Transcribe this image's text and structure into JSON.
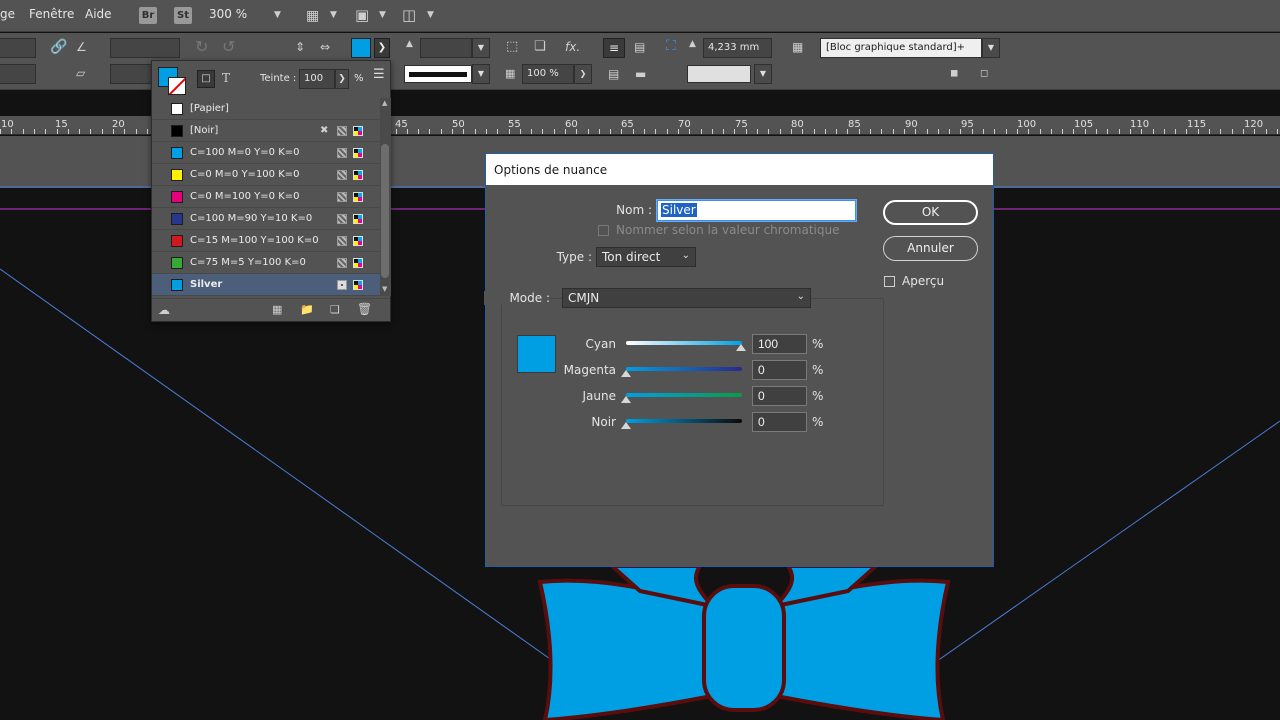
{
  "menubar": {
    "items": [
      "ge",
      "Fenêtre",
      "Aide"
    ],
    "bridge_badge": "Br",
    "stock_badge": "St",
    "zoom": "300 %"
  },
  "control": {
    "stroke_weight": "4,233 mm",
    "opacity": "100 %",
    "object_style": "[Bloc graphique standard]+"
  },
  "ruler": {
    "labels": [
      "10",
      "15",
      "20",
      "45",
      "50",
      "55",
      "60",
      "65",
      "70",
      "75",
      "80",
      "85",
      "90",
      "95",
      "100",
      "105",
      "110",
      "115",
      "120"
    ]
  },
  "swatches_panel": {
    "tint_label": "Teinte :",
    "tint_value": "100",
    "tint_unit": "%",
    "items": [
      {
        "label": "[Papier]",
        "color": "#ffffff",
        "kind": "none"
      },
      {
        "label": "[Noir]",
        "color": "#000000",
        "kind": "locked"
      },
      {
        "label": "C=100 M=0 Y=0 K=0",
        "color": "#00a0e6",
        "kind": "process"
      },
      {
        "label": "C=0 M=0 Y=100 K=0",
        "color": "#fff200",
        "kind": "process"
      },
      {
        "label": "C=0 M=100 Y=0 K=0",
        "color": "#e6007e",
        "kind": "process"
      },
      {
        "label": "C=100 M=90 Y=10 K=0",
        "color": "#27378c",
        "kind": "process"
      },
      {
        "label": "C=15 M=100 Y=100 K=0",
        "color": "#d0181f",
        "kind": "process"
      },
      {
        "label": "C=75 M=5 Y=100 K=0",
        "color": "#39a935",
        "kind": "process"
      },
      {
        "label": "Silver",
        "color": "#009fe3",
        "kind": "spot"
      }
    ]
  },
  "dialog": {
    "title": "Options de nuance",
    "name_label": "Nom :",
    "name_value": "Silver",
    "name_by_value_label": "Nommer selon la valeur chromatique",
    "type_label": "Type :",
    "type_value": "Ton direct",
    "mode_label": "Mode :",
    "mode_value": "CMJN",
    "ok_label": "OK",
    "cancel_label": "Annuler",
    "preview_label": "Aperçu",
    "swatch_color": "#009fe3",
    "channels": [
      {
        "label": "Cyan",
        "value": "100",
        "unit": "%"
      },
      {
        "label": "Magenta",
        "value": "0",
        "unit": "%"
      },
      {
        "label": "Jaune",
        "value": "0",
        "unit": "%"
      },
      {
        "label": "Noir",
        "value": "0",
        "unit": "%"
      }
    ]
  },
  "colors": {
    "accent_blue": "#009fe3",
    "bow_outline": "#5a0d0d",
    "guide_magenta": "#c13bd3",
    "guide_blue": "#4c7fd9"
  }
}
